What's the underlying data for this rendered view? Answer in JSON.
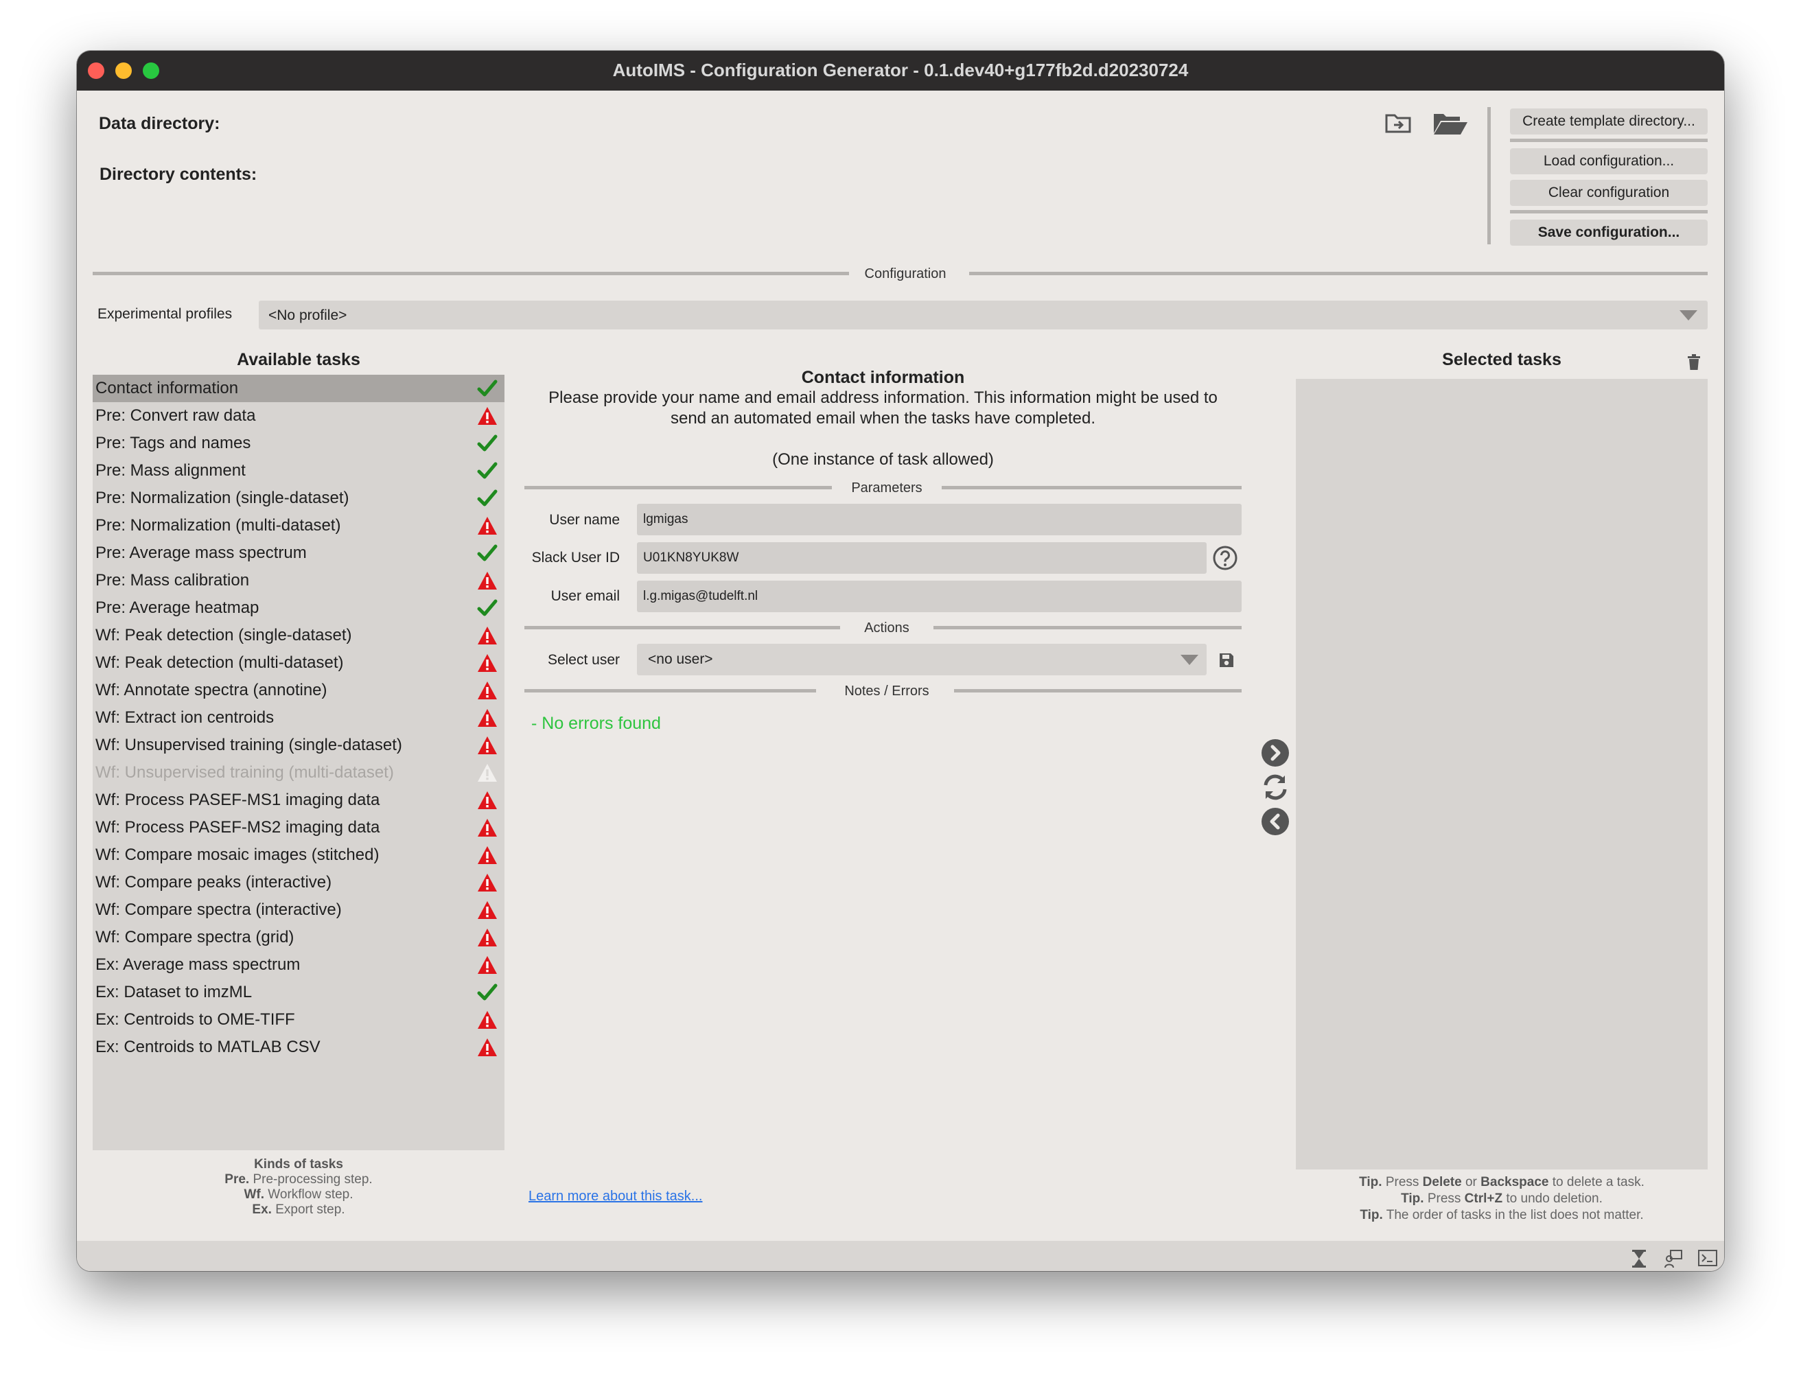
{
  "window": {
    "title": "AutoIMS - Configuration Generator - 0.1.dev40+g177fb2d.d20230724"
  },
  "header": {
    "data_directory_label": "Data directory:",
    "directory_contents_label": "Directory contents:",
    "buttons": {
      "create_template": "Create template directory...",
      "load_config": "Load configuration...",
      "clear_config": "Clear configuration",
      "save_config": "Save configuration..."
    }
  },
  "configuration": {
    "section_title": "Configuration",
    "profiles_label": "Experimental profiles",
    "profile_value": "<No profile>"
  },
  "available_tasks": {
    "title": "Available tasks",
    "items": [
      {
        "label": "Contact information",
        "status": "ok",
        "selected": true
      },
      {
        "label": "Pre: Convert raw data",
        "status": "error"
      },
      {
        "label": "Pre: Tags and names",
        "status": "ok"
      },
      {
        "label": "Pre: Mass alignment",
        "status": "ok"
      },
      {
        "label": "Pre: Normalization (single-dataset)",
        "status": "ok"
      },
      {
        "label": "Pre: Normalization (multi-dataset)",
        "status": "error"
      },
      {
        "label": "Pre: Average mass spectrum",
        "status": "ok"
      },
      {
        "label": "Pre: Mass calibration",
        "status": "error"
      },
      {
        "label": "Pre: Average heatmap",
        "status": "ok"
      },
      {
        "label": "Wf: Peak detection (single-dataset)",
        "status": "error"
      },
      {
        "label": "Wf: Peak detection (multi-dataset)",
        "status": "error"
      },
      {
        "label": "Wf: Annotate spectra (annotine)",
        "status": "error"
      },
      {
        "label": "Wf: Extract ion centroids",
        "status": "error"
      },
      {
        "label": "Wf: Unsupervised training (single-dataset)",
        "status": "error"
      },
      {
        "label": "Wf: Unsupervised training (multi-dataset)",
        "status": "disabled"
      },
      {
        "label": "Wf: Process PASEF-MS1 imaging data",
        "status": "error"
      },
      {
        "label": "Wf: Process PASEF-MS2 imaging data",
        "status": "error"
      },
      {
        "label": "Wf: Compare mosaic images (stitched)",
        "status": "error"
      },
      {
        "label": "Wf: Compare peaks (interactive)",
        "status": "error"
      },
      {
        "label": "Wf: Compare spectra (interactive)",
        "status": "error"
      },
      {
        "label": "Wf: Compare spectra (grid)",
        "status": "error"
      },
      {
        "label": "Ex: Average mass spectrum",
        "status": "error"
      },
      {
        "label": "Ex: Dataset to imzML",
        "status": "ok"
      },
      {
        "label": "Ex: Centroids to OME-TIFF",
        "status": "error"
      },
      {
        "label": "Ex: Centroids to MATLAB CSV",
        "status": "error"
      }
    ],
    "legend": {
      "title": "Kinds of tasks",
      "pre_key": "Pre.",
      "pre_text": "Pre-processing step.",
      "wf_key": "Wf.",
      "wf_text": "Workflow step.",
      "ex_key": "Ex.",
      "ex_text": "Export step."
    }
  },
  "task_panel": {
    "title": "Contact information",
    "description_1": "Please provide your name and email address information. This information might be used to",
    "description_2": "send an automated email when the tasks have completed.",
    "instance_note": "(One instance of task allowed)",
    "parameters_title": "Parameters",
    "user_name_label": "User name",
    "user_name_value": "lgmigas",
    "slack_label": "Slack User ID",
    "slack_value": "U01KN8YUK8W",
    "email_label": "User email",
    "email_value": "l.g.migas@tudelft.nl",
    "actions_title": "Actions",
    "select_user_label": "Select user",
    "select_user_value": "<no user>",
    "notes_title": "Notes / Errors",
    "notes_text": "- No errors found",
    "learn_more": "Learn more about this task..."
  },
  "selected_tasks": {
    "title": "Selected tasks",
    "tip_prefix": "Tip.",
    "tip1_a": "Press",
    "tip1_k1": "Delete",
    "tip1_b": "or",
    "tip1_k2": "Backspace",
    "tip1_c": "to delete a task.",
    "tip2_a": "Press",
    "tip2_k": "Ctrl+Z",
    "tip2_b": "to undo deletion.",
    "tip3": "The order of tasks in the list does not matter."
  },
  "colors": {
    "ok": "#1f8a1f",
    "error": "#e0151b",
    "disabled": "#f2f0ee",
    "success_text": "#2ec43f",
    "link": "#2a73e6"
  }
}
